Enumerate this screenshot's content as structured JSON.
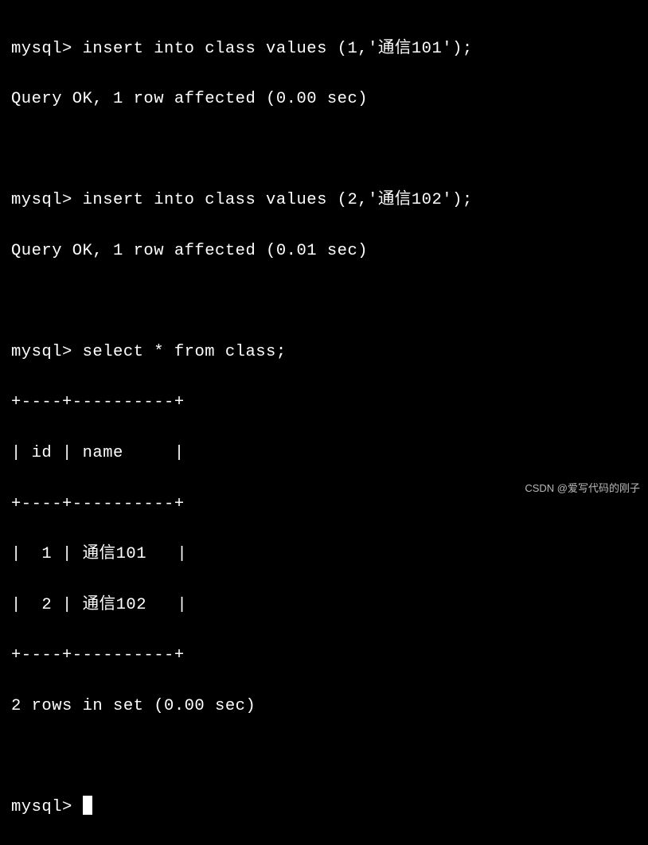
{
  "prompt": "mysql> ",
  "commands": {
    "insert1": "insert into class values (1,'通信101');",
    "insert1_result": "Query OK, 1 row affected (0.00 sec)",
    "insert2": "insert into class values (2,'通信102');",
    "insert2_result": "Query OK, 1 row affected (0.01 sec)",
    "select": "select * from class;"
  },
  "table": {
    "border_top": "+----+----------+",
    "header": "| id | name     |",
    "border_mid": "+----+----------+",
    "rows": [
      "|  1 | 通信101   |",
      "|  2 | 通信102   |"
    ],
    "border_bot": "+----+----------+",
    "footer": "2 rows in set (0.00 sec)"
  },
  "chart_data": {
    "type": "table",
    "columns": [
      "id",
      "name"
    ],
    "rows": [
      [
        1,
        "通信101"
      ],
      [
        2,
        "通信102"
      ]
    ]
  },
  "watermark": "CSDN @爱写代码的刚子"
}
